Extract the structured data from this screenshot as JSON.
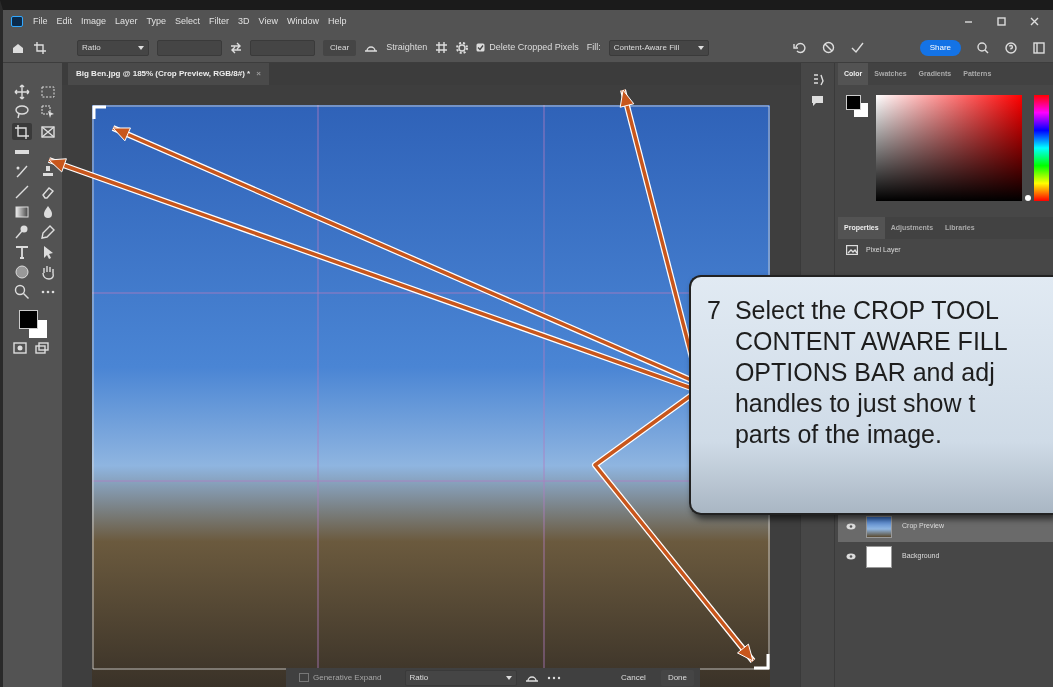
{
  "menu_bar": {
    "items": [
      "File",
      "Edit",
      "Image",
      "Layer",
      "Type",
      "Select",
      "Filter",
      "3D",
      "View",
      "Window",
      "Help"
    ]
  },
  "options_bar": {
    "aspect": "Ratio",
    "clear": "Clear",
    "straighten": "Straighten",
    "delete_cropped_pixels": {
      "label": "Delete Cropped Pixels",
      "checked": true
    },
    "fill_label": "Fill:",
    "fill": "Content-Aware Fill",
    "share": "Share"
  },
  "document_tab": {
    "title": "Big Ben.jpg @ 185% (Crop Preview, RGB/8#) *",
    "close": "×"
  },
  "toolbar": {
    "tools": [
      {
        "selected": false
      },
      {
        "selected": false
      },
      {
        "selected": false
      },
      {
        "selected": false
      },
      {
        "selected": true
      },
      {
        "selected": false
      },
      {
        "selected": false
      },
      {
        "selected": false
      },
      {
        "selected": false
      },
      {
        "selected": false
      },
      {
        "selected": false
      },
      {
        "selected": false
      },
      {
        "selected": false
      },
      {
        "selected": false
      },
      {
        "selected": false
      },
      {
        "selected": false
      },
      {
        "selected": false
      },
      {
        "selected": false
      },
      {
        "selected": false
      },
      {
        "selected": false
      },
      {
        "selected": false
      }
    ]
  },
  "color_panel": {
    "hue_slider": {
      "level": 0
    },
    "tabs": [
      {
        "label": "Color",
        "selected": true
      },
      {
        "label": "Swatches",
        "selected": false
      },
      {
        "label": "Gradients",
        "selected": false
      },
      {
        "label": "Patterns",
        "selected": false
      }
    ]
  },
  "properties_panel": {
    "tabs": [
      {
        "label": "Properties",
        "selected": true
      },
      {
        "label": "Adjustments",
        "selected": false
      },
      {
        "label": "Libraries",
        "selected": false
      }
    ],
    "layer_type": "Pixel Layer"
  },
  "layers": [
    {
      "name": "Crop Preview",
      "selected": true,
      "visible": true,
      "kind": "photo"
    },
    {
      "name": "Background",
      "selected": false,
      "visible": true,
      "kind": "white"
    }
  ],
  "contextual_bar": {
    "generative_expand": {
      "label": "Generative Expand",
      "disabled": true
    },
    "aspect": "Ratio",
    "cancel": "Cancel",
    "done": "Done"
  },
  "callout": {
    "number": "7",
    "lines": [
      "Select the CROP TOOL",
      "CONTENT AWARE FILL",
      "OPTIONS BAR and adj",
      "handles to just show t",
      "parts of the image."
    ]
  }
}
